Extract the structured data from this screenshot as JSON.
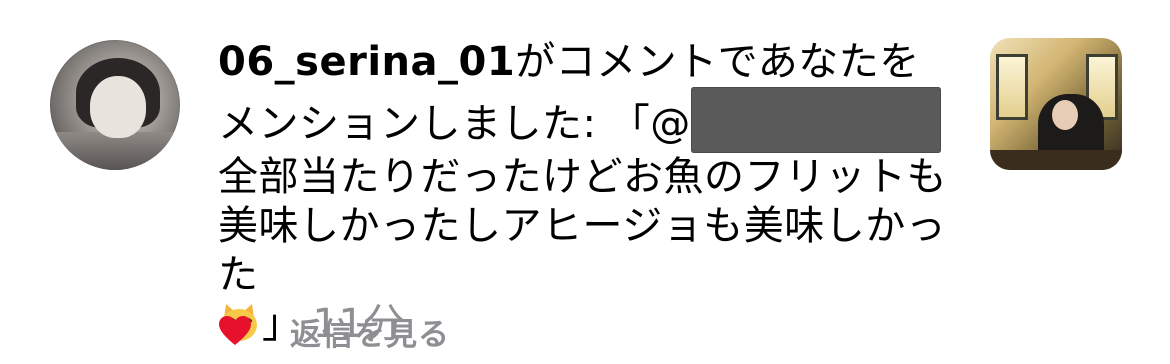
{
  "notification": {
    "username": "06_serina_01",
    "message_part1": "がコメントであなたをメンションしました: 「@",
    "message_part2": " 全部当たりだったけどお魚のフリットも美味しかったしアヒージョも美味しかった",
    "closing_bracket": "」",
    "timestamp": "11分",
    "emoji": "grinning-cat-with-smiling-eyes"
  },
  "actions": {
    "like_icon": "heart-icon",
    "like_color": "#e8112d",
    "reply_label": "返信を見る"
  },
  "colors": {
    "secondary_text": "#8e8e93",
    "redaction": "#5a5a5a"
  }
}
